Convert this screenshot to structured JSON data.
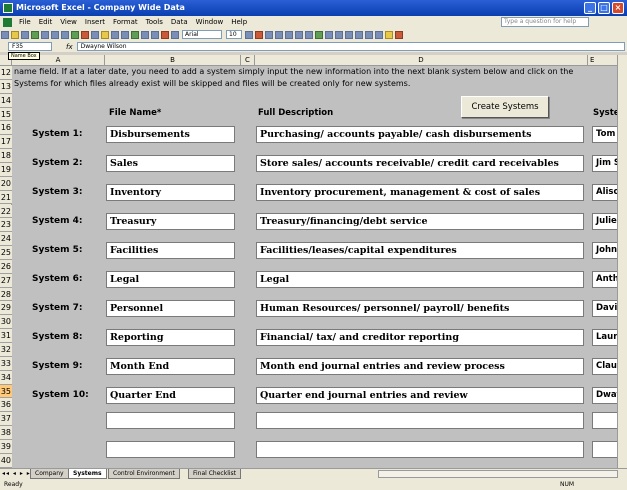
{
  "window": {
    "title": "Microsoft Excel - Company Wide Data"
  },
  "menu": [
    "File",
    "Edit",
    "View",
    "Insert",
    "Format",
    "Tools",
    "Data",
    "Window",
    "Help"
  ],
  "help_placeholder": "Type a question for help",
  "toolbar": {
    "font": "Arial",
    "size": "10"
  },
  "formula_bar": {
    "cell_ref": "F35",
    "fx": "fx",
    "value": "Dwayne Wilson",
    "name_box_tooltip": "Name Box"
  },
  "columns": [
    "A",
    "B",
    "C",
    "D",
    "E"
  ],
  "instructions": {
    "line12": "name field.  If at a later date, you need to add a system simply input the new information into the next blank system below and click on the",
    "line13": "Systems for which files already exist will be skipped and files will be created only for new systems."
  },
  "create_button": "Create Systems",
  "headers": {
    "file_name": "File Name*",
    "full_description": "Full Description",
    "system_owner": "Syste"
  },
  "rows": [
    "12",
    "13",
    "14",
    "15",
    "16",
    "17",
    "18",
    "19",
    "20",
    "21",
    "22",
    "23",
    "24",
    "25",
    "26",
    "27",
    "28",
    "29",
    "30",
    "31",
    "32",
    "33",
    "34",
    "35",
    "36",
    "37",
    "38",
    "39",
    "40"
  ],
  "systems": [
    {
      "label": "System 1:",
      "file": "Disbursements",
      "desc": "Purchasing/ accounts payable/ cash disbursements",
      "owner": "Tom D"
    },
    {
      "label": "System 2:",
      "file": "Sales",
      "desc": "Store sales/ accounts receivable/ credit card receivables",
      "owner": "Jim S"
    },
    {
      "label": "System 3:",
      "file": "Inventory",
      "desc": "Inventory procurement, management & cost of sales",
      "owner": "Alison"
    },
    {
      "label": "System 4:",
      "file": "Treasury",
      "desc": "Treasury/financing/debt service",
      "owner": "Julie"
    },
    {
      "label": "System 5:",
      "file": "Facilities",
      "desc": "Facilities/leases/capital expenditures",
      "owner": "John"
    },
    {
      "label": "System 6:",
      "file": "Legal",
      "desc": "Legal",
      "owner": "Antho"
    },
    {
      "label": "System 7:",
      "file": "Personnel",
      "desc": "Human Resources/ personnel/ payroll/ benefits",
      "owner": "David"
    },
    {
      "label": "System 8:",
      "file": "Reporting",
      "desc": "Financial/ tax/ and creditor reporting",
      "owner": "Laura"
    },
    {
      "label": "System 9:",
      "file": "Month End",
      "desc": "Month end journal entries and review process",
      "owner": "Claud"
    },
    {
      "label": "System 10:",
      "file": "Quarter End",
      "desc": "Quarter end journal entries and review",
      "owner": "Dwayn"
    }
  ],
  "tabs": [
    "Company",
    "Systems",
    "Control Environment",
    "Final Checklist"
  ],
  "status": {
    "left": "Ready",
    "right": "NUM"
  }
}
